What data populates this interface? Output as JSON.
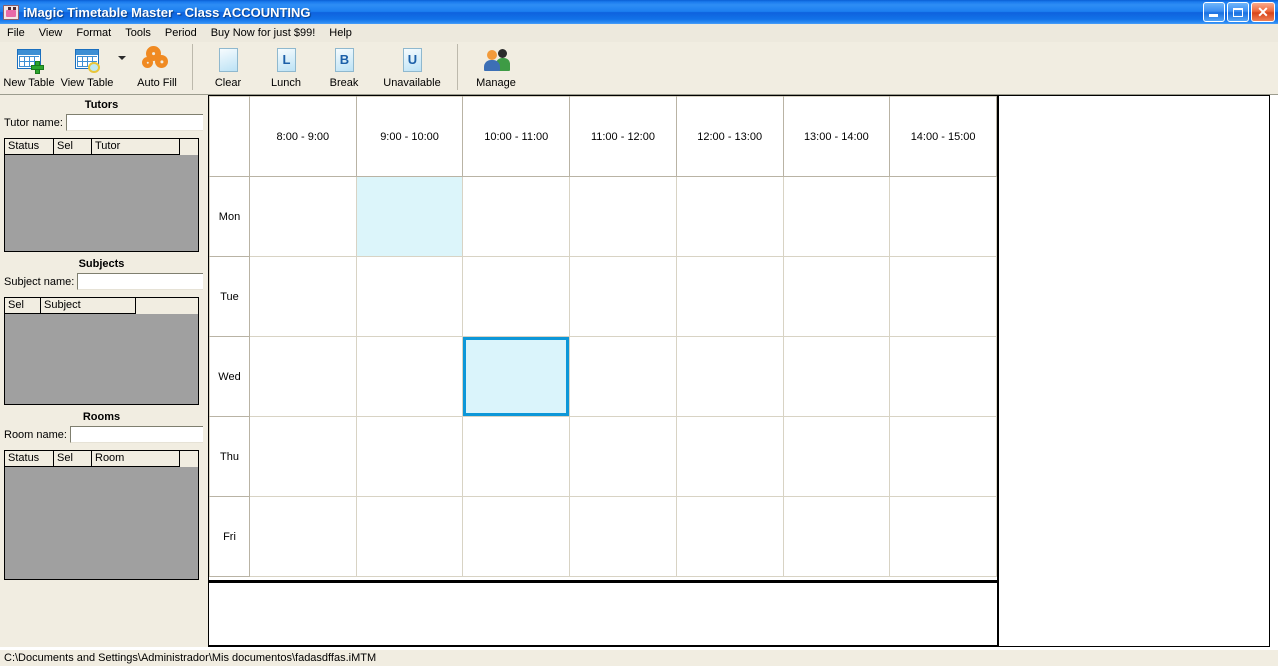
{
  "window": {
    "app_title": "iMagic Timetable Master",
    "document_title": "- Class ACCOUNTING",
    "icon": "app-icon",
    "buttons": {
      "minimize": "minimize-button",
      "restore": "restore-button",
      "close": "close-button"
    }
  },
  "menu": {
    "items": [
      {
        "label": "File"
      },
      {
        "label": "View"
      },
      {
        "label": "Format"
      },
      {
        "label": "Tools"
      },
      {
        "label": "Period"
      },
      {
        "label": "Buy Now for just $99!"
      },
      {
        "label": "Help"
      }
    ]
  },
  "toolbar": {
    "buttons": [
      {
        "label": "New Table",
        "icon": "table-add-icon"
      },
      {
        "label": "View Table",
        "icon": "table-view-icon"
      },
      {
        "label": "Auto Fill",
        "icon": "gears-icon"
      },
      {
        "label": "Clear",
        "icon": "blank-square-icon",
        "glyph": ""
      },
      {
        "label": "Lunch",
        "icon": "lunch-square-icon",
        "glyph": "L"
      },
      {
        "label": "Break",
        "icon": "break-square-icon",
        "glyph": "B"
      },
      {
        "label": "Unavailable",
        "icon": "unavailable-square-icon",
        "glyph": "U"
      },
      {
        "label": "Manage",
        "icon": "people-icon"
      }
    ]
  },
  "sidebar": {
    "tutors": {
      "title": "Tutors",
      "name_label": "Tutor name:",
      "name_value": "",
      "columns": [
        "Status",
        "Sel",
        "Tutor"
      ],
      "rows": []
    },
    "subjects": {
      "title": "Subjects",
      "name_label": "Subject name:",
      "name_value": "",
      "columns": [
        "Sel",
        "Subject"
      ],
      "rows": []
    },
    "rooms": {
      "title": "Rooms",
      "name_label": "Room name:",
      "name_value": "",
      "columns": [
        "Status",
        "Sel",
        "Room"
      ],
      "rows": []
    }
  },
  "timetable": {
    "time_slots": [
      "8:00 - 9:00",
      "9:00 - 10:00",
      "10:00 - 11:00",
      "11:00 - 12:00",
      "12:00 - 13:00",
      "13:00 - 14:00",
      "14:00 - 15:00"
    ],
    "days": [
      "Mon",
      "Tue",
      "Wed",
      "Thu",
      "Fri"
    ],
    "cells": [
      [
        "",
        "busy",
        "",
        "",
        "",
        "",
        ""
      ],
      [
        "",
        "",
        "",
        "",
        "",
        "",
        ""
      ],
      [
        "",
        "",
        "selected",
        "",
        "",
        "",
        ""
      ],
      [
        "",
        "",
        "",
        "",
        "",
        "",
        ""
      ],
      [
        "",
        "",
        "",
        "",
        "",
        "",
        ""
      ]
    ],
    "colors": {
      "busy_fill": "#DCF5FA",
      "selected_fill": "#DAF4FB",
      "selected_border": "#0D97D8",
      "gridline": "#D8D3C4"
    }
  },
  "statusbar": {
    "path": "C:\\Documents and Settings\\Administrador\\Mis documentos\\fadasdffas.iMTM"
  }
}
